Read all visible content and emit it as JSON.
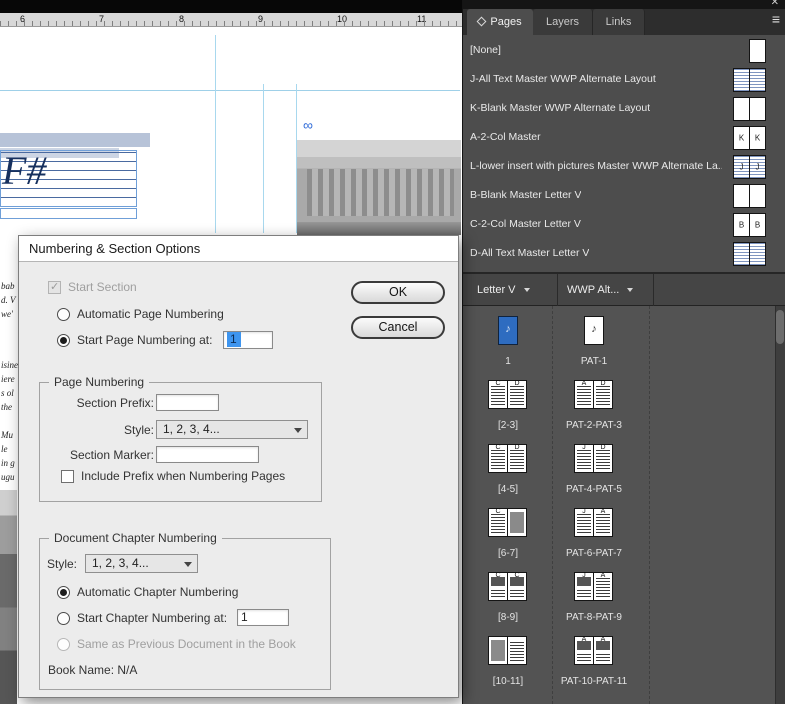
{
  "window": {
    "close_icon": "✕"
  },
  "ruler": {
    "ticks": [
      "6",
      "7",
      "8",
      "9",
      "10",
      "11"
    ]
  },
  "document": {
    "fsharp_text": "F#",
    "thread_icon": "∞",
    "fragments": [
      "bab",
      "d. V",
      "we'",
      "isine",
      "iere",
      "s ol",
      "the",
      "Mu",
      "le",
      "in g",
      "ugu"
    ]
  },
  "dialog": {
    "title": "Numbering & Section Options",
    "ok_label": "OK",
    "cancel_label": "Cancel",
    "start_section_label": "Start Section",
    "auto_page_label": "Automatic Page Numbering",
    "start_page_label": "Start Page Numbering at:",
    "start_page_value": "1",
    "page_numbering": {
      "legend": "Page Numbering",
      "section_prefix_label": "Section Prefix:",
      "style_label": "Style:",
      "style_value": "1, 2, 3, 4...",
      "section_marker_label": "Section Marker:",
      "include_prefix_label": "Include Prefix when Numbering Pages"
    },
    "chapter_numbering": {
      "legend": "Document Chapter Numbering",
      "style_label": "Style:",
      "style_value": "1, 2, 3, 4...",
      "auto_chapter_label": "Automatic Chapter Numbering",
      "start_chapter_label": "Start Chapter Numbering at:",
      "start_chapter_value": "1",
      "same_as_previous_label": "Same as Previous Document in the Book",
      "book_name_label": "Book Name: N/A"
    }
  },
  "panel": {
    "tabs": [
      "Pages",
      "Layers",
      "Links"
    ],
    "menu_icon": "≡",
    "cover_glyph": "♪",
    "masters": [
      {
        "name": "[None]"
      },
      {
        "name": "J-All Text Master WWP Alternate Layout"
      },
      {
        "name": "K-Blank Master WWP Alternate Layout"
      },
      {
        "name": "A-2-Col Master",
        "letters": [
          "K",
          "K"
        ]
      },
      {
        "name": "L-lower insert with pictures  Master WWP Alternate La...",
        "letters": [
          "J",
          "J"
        ]
      },
      {
        "name": "B-Blank Master Letter V"
      },
      {
        "name": "C-2-Col Master Letter V",
        "letters": [
          "B",
          "B"
        ]
      },
      {
        "name": "D-All Text Master Letter V"
      }
    ],
    "sections": [
      {
        "label": "Letter V"
      },
      {
        "label": "WWP Alt..."
      }
    ],
    "spreads": {
      "left": [
        {
          "label": "1"
        },
        {
          "label": "[2-3]",
          "letters": [
            "C",
            "D"
          ]
        },
        {
          "label": "[4-5]",
          "letters": [
            "C",
            "D"
          ]
        },
        {
          "label": "[6-7]",
          "letters": [
            "C",
            ""
          ]
        },
        {
          "label": "[8-9]",
          "letters": [
            "C",
            "C"
          ]
        },
        {
          "label": "[10-11]",
          "letters": [
            "",
            ""
          ]
        }
      ],
      "right": [
        {
          "label": "PAT-1"
        },
        {
          "label": "PAT-2-PAT-3",
          "letters": [
            "A",
            "D"
          ]
        },
        {
          "label": "PAT-4-PAT-5",
          "letters": [
            "J",
            "D"
          ]
        },
        {
          "label": "PAT-6-PAT-7",
          "letters": [
            "J",
            "A"
          ]
        },
        {
          "label": "PAT-8-PAT-9",
          "letters": [
            "J",
            "A"
          ]
        },
        {
          "label": "PAT-10-PAT-11",
          "letters": [
            "A",
            "A"
          ]
        }
      ]
    }
  },
  "colors": {
    "selection_blue": "#3e95ef",
    "page_cover_blue": "#2e6cc0",
    "guide_cyan": "#9fd0e8",
    "panel_bg": "#4d4d4d"
  }
}
